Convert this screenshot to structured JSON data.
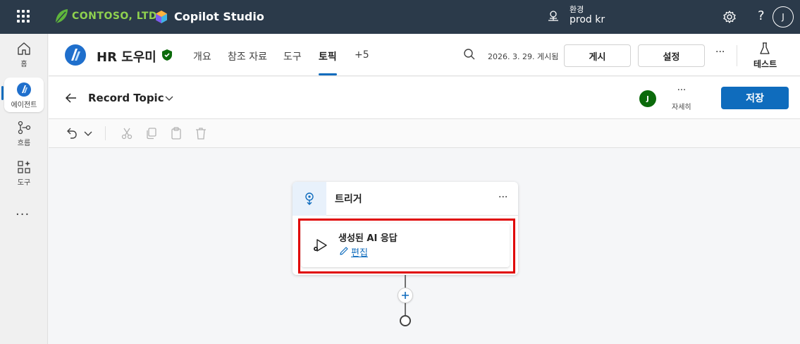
{
  "topbar": {
    "org_name": "CONTOSO, LTD.",
    "app_name": "Copilot Studio",
    "env_label": "환경",
    "env_value": "prod kr",
    "help": "?",
    "user_initial": "J"
  },
  "leftnav": {
    "items": [
      {
        "label": "홈",
        "icon": "home-icon"
      },
      {
        "label": "에이전트",
        "icon": "agent-icon"
      },
      {
        "label": "흐름",
        "icon": "flow-icon"
      },
      {
        "label": "도구",
        "icon": "tools-icon"
      }
    ],
    "more": "···"
  },
  "agent": {
    "name": "HR 도우미",
    "tabs": [
      "개요",
      "참조 자료",
      "도구",
      "토픽",
      "+5"
    ],
    "active_tab": "토픽",
    "published": "2026. 3. 29. 게시됨",
    "publish_label": "게시",
    "settings_label": "설정",
    "more": "···",
    "test_label": "테스트"
  },
  "topic": {
    "title": "Record Topic",
    "user_initial": "J",
    "more": "···",
    "more_label": "자세히",
    "save_label": "저장"
  },
  "canvas": {
    "trigger_title": "트리거",
    "trigger_more": "···",
    "node_title": "생성된 AI 응답",
    "edit_label": "편집"
  },
  "colors": {
    "topbar_bg": "#2b3a4a",
    "accent": "#0f6cbd",
    "brand_green": "#8fd14f",
    "highlight": "#e00000"
  }
}
